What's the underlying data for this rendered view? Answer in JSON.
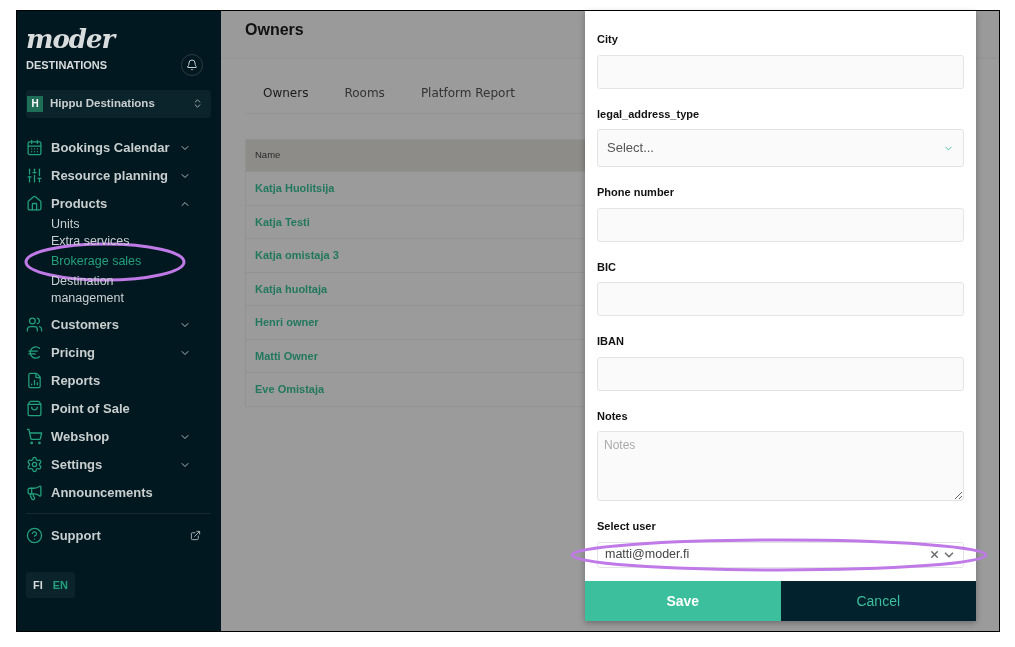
{
  "brand": {
    "logo": "moder",
    "subtitle": "DESTINATIONS"
  },
  "organization": {
    "initial": "H",
    "name": "Hippu Destinations"
  },
  "menu": [
    {
      "label": "Bookings Calendar",
      "kind": "group",
      "expanded": false
    },
    {
      "label": "Resource planning",
      "kind": "group",
      "expanded": false
    },
    {
      "label": "Products",
      "kind": "group",
      "expanded": true,
      "children": [
        {
          "label": "Units",
          "selected": false
        },
        {
          "label": "Extra services",
          "selected": false
        },
        {
          "label": "Brokerage sales",
          "selected": true
        },
        {
          "label": "Destination management",
          "selected": false
        }
      ]
    },
    {
      "label": "Customers",
      "kind": "group",
      "expanded": false
    },
    {
      "label": "Pricing",
      "kind": "group",
      "expanded": false
    },
    {
      "label": "Reports",
      "kind": "link"
    },
    {
      "label": "Point of Sale",
      "kind": "link"
    },
    {
      "label": "Webshop",
      "kind": "group",
      "expanded": false
    },
    {
      "label": "Settings",
      "kind": "group",
      "expanded": false
    },
    {
      "label": "Announcements",
      "kind": "link"
    }
  ],
  "support": {
    "label": "Support"
  },
  "languages": [
    {
      "label": "FI",
      "selected": true
    },
    {
      "label": "EN",
      "selected": false
    }
  ],
  "page": {
    "title": "Owners",
    "tabs": [
      {
        "label": "Owners",
        "selected": true
      },
      {
        "label": "Rooms",
        "selected": false
      },
      {
        "label": "Platform Report",
        "selected": false
      }
    ],
    "table": {
      "columns": [
        "Name"
      ],
      "rows": [
        "Katja Huolitsija",
        "Katja Testi",
        "Katja omistaja 3",
        "Katja huoltaja",
        "Henri owner",
        "Matti Owner",
        "Eve Omistaja"
      ]
    }
  },
  "form": {
    "fields": [
      {
        "label": "City",
        "kind": "text"
      },
      {
        "label": "legal_address_type",
        "kind": "select",
        "placeholder": "Select..."
      },
      {
        "label": "Phone number",
        "kind": "text"
      },
      {
        "label": "BIC",
        "kind": "text"
      },
      {
        "label": "IBAN",
        "kind": "text"
      },
      {
        "label": "Notes",
        "kind": "textarea",
        "placeholder": "Notes"
      },
      {
        "label": "Select user",
        "kind": "user",
        "value": "matti@moder.fi"
      }
    ],
    "buttons": [
      {
        "label": "Save",
        "kind": "primary"
      },
      {
        "label": "Cancel",
        "kind": "secondary"
      }
    ]
  }
}
